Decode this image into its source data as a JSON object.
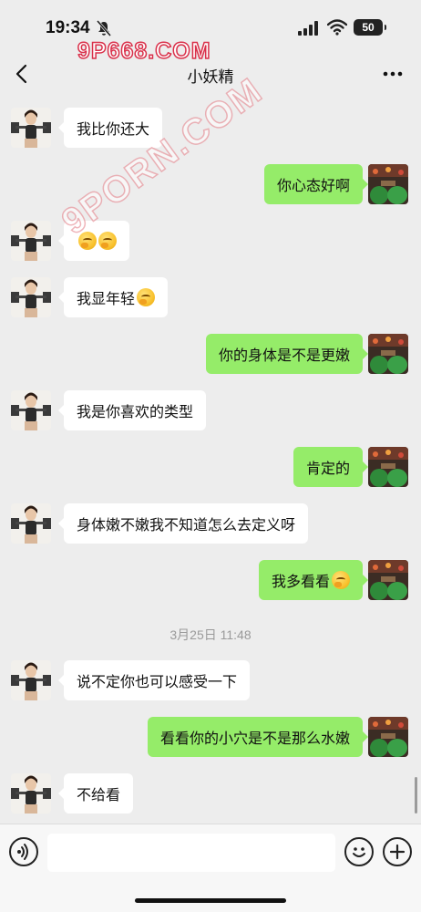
{
  "status_bar": {
    "time": "19:34",
    "battery": "50"
  },
  "watermarks": {
    "top": "9P668.COM",
    "diagonal": "9PORN.COM"
  },
  "header": {
    "title": "小妖精"
  },
  "messages": [
    {
      "side": "left",
      "text": "我比你还大",
      "emojis": 0
    },
    {
      "side": "right",
      "text": "你心态好啊",
      "emojis": 0
    },
    {
      "side": "left",
      "text": "",
      "emojis": 2
    },
    {
      "side": "left",
      "text": "我显年轻",
      "emojis": 1
    },
    {
      "side": "right",
      "text": "你的身体是不是更嫩",
      "emojis": 0
    },
    {
      "side": "left",
      "text": "我是你喜欢的类型",
      "emojis": 0
    },
    {
      "side": "right",
      "text": "肯定的",
      "emojis": 0
    },
    {
      "side": "left",
      "text": "身体嫩不嫩我不知道怎么去定义呀",
      "emojis": 0
    },
    {
      "side": "right",
      "text": "我多看看",
      "emojis": 1
    },
    {
      "side": "left",
      "text": "说不定你也可以感受一下",
      "emojis": 0
    },
    {
      "side": "right",
      "text": "看看你的小穴是不是那么水嫩",
      "emojis": 0
    },
    {
      "side": "left",
      "text": "不给看",
      "emojis": 0
    }
  ],
  "timestamp": "3月25日 11:48",
  "input": {
    "value": "",
    "placeholder": ""
  },
  "icons": {
    "back": "chevron-left-icon",
    "more": "more-icon",
    "voice": "voice-icon",
    "emoji": "emoji-icon",
    "plus": "plus-icon",
    "reaction_emoji": "thinking-face-emoji"
  },
  "colors": {
    "background": "#ededed",
    "sent_bubble": "#95ec69",
    "received_bubble": "#ffffff"
  }
}
